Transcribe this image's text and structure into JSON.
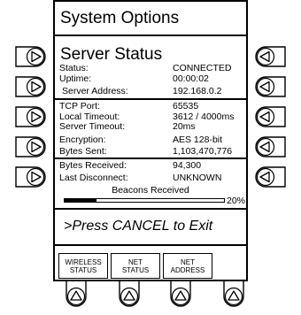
{
  "title": "System Options",
  "subtitle": "Server Status",
  "status_rows": [
    {
      "label": "Status:",
      "value": "CONNECTED"
    },
    {
      "label": "Uptime:",
      "value": "00:00:02"
    },
    {
      "label": "Server Address:",
      "value": "192.168.0.2"
    },
    {
      "label": "TCP Port:",
      "value": "65535"
    },
    {
      "label": "Local Timeout:",
      "value": "3612 / 4000ms"
    },
    {
      "label": "Server Timeout:",
      "value": "20ms"
    },
    {
      "label": "Encryption:",
      "value": "AES 128-bit"
    },
    {
      "label": "Bytes Sent:",
      "value": "1,103,470,776"
    },
    {
      "label": "Bytes Received:",
      "value": "94,300"
    },
    {
      "label": "Last Disconnect:",
      "value": "UNKNOWN"
    }
  ],
  "beacons": {
    "label": "Beacons Received",
    "percent_text": "20%",
    "percent": 20
  },
  "prompt": ">Press CANCEL to Exit",
  "softkeys": [
    {
      "line1": "WIRELESS",
      "line2": "STATUS"
    },
    {
      "line1": "NET",
      "line2": "STATUS"
    },
    {
      "line1": "NET",
      "line2": "ADDRESS"
    }
  ],
  "icons": {
    "left": "triangle-right-icon",
    "right": "triangle-left-icon",
    "bottom": "triangle-up-icon"
  }
}
